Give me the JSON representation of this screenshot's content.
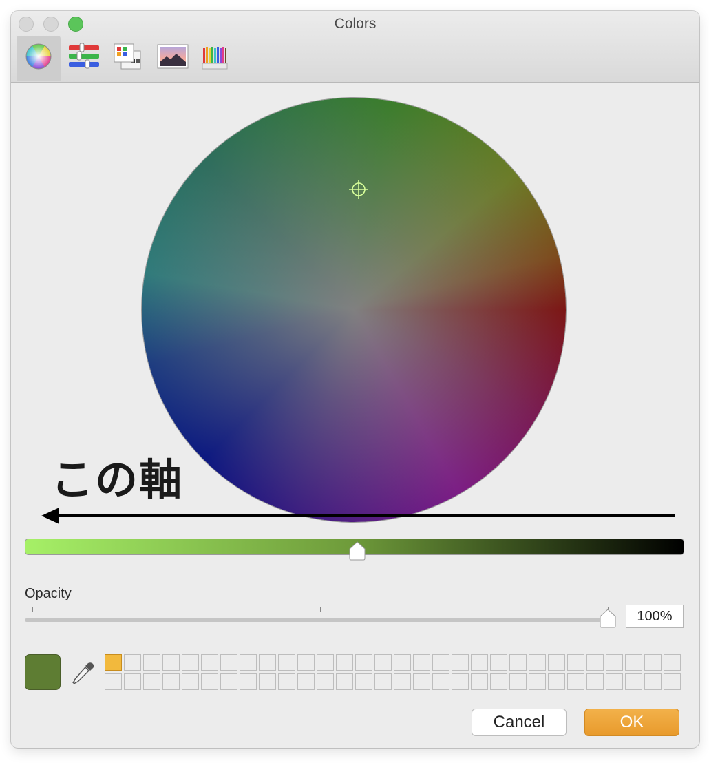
{
  "window": {
    "title": "Colors"
  },
  "toolbar": {
    "tabs": [
      {
        "name": "color-wheel",
        "icon": "color-wheel-icon",
        "active": true
      },
      {
        "name": "color-sliders",
        "icon": "sliders-icon",
        "active": false
      },
      {
        "name": "color-palettes",
        "icon": "palettes-icon",
        "active": false
      },
      {
        "name": "image-palettes",
        "icon": "image-icon",
        "active": false
      },
      {
        "name": "pencils",
        "icon": "pencils-icon",
        "active": false
      }
    ]
  },
  "annotation": {
    "text": "この軸",
    "arrow_direction": "left"
  },
  "brightness_slider": {
    "gradient_start": "#a6f067",
    "gradient_end": "#000000",
    "value_fraction": 0.5
  },
  "opacity": {
    "label": "Opacity",
    "value": "100%",
    "value_fraction": 1.0
  },
  "current_color": "#5e7d33",
  "swatches": {
    "filled_color": "#f2b93d",
    "filled_index": 0,
    "rows": 2,
    "columns": 30
  },
  "buttons": {
    "cancel_label": "Cancel",
    "ok_label": "OK"
  }
}
